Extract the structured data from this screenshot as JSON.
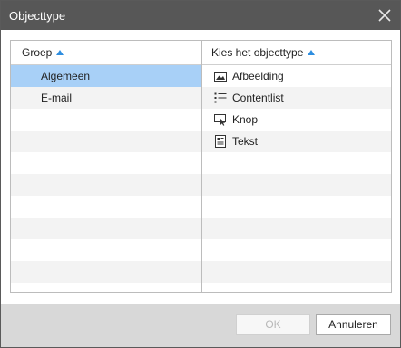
{
  "dialog": {
    "title": "Objecttype",
    "close_icon": "close-icon"
  },
  "left_column": {
    "header": "Groep",
    "rows": [
      {
        "label": "Algemeen",
        "selected": true
      },
      {
        "label": "E-mail",
        "selected": false
      }
    ]
  },
  "right_column": {
    "header": "Kies het objecttype",
    "rows": [
      {
        "label": "Afbeelding",
        "icon": "image-icon"
      },
      {
        "label": "Contentlist",
        "icon": "list-icon"
      },
      {
        "label": "Knop",
        "icon": "button-icon"
      },
      {
        "label": "Tekst",
        "icon": "text-icon"
      }
    ]
  },
  "buttons": {
    "ok_label": "OK",
    "cancel_label": "Annuleren"
  },
  "colors": {
    "titlebar": "#575757",
    "selected_row": "#a8d0f7",
    "sort_arrow": "#2f8ee0",
    "footer": "#d8d8d8"
  }
}
